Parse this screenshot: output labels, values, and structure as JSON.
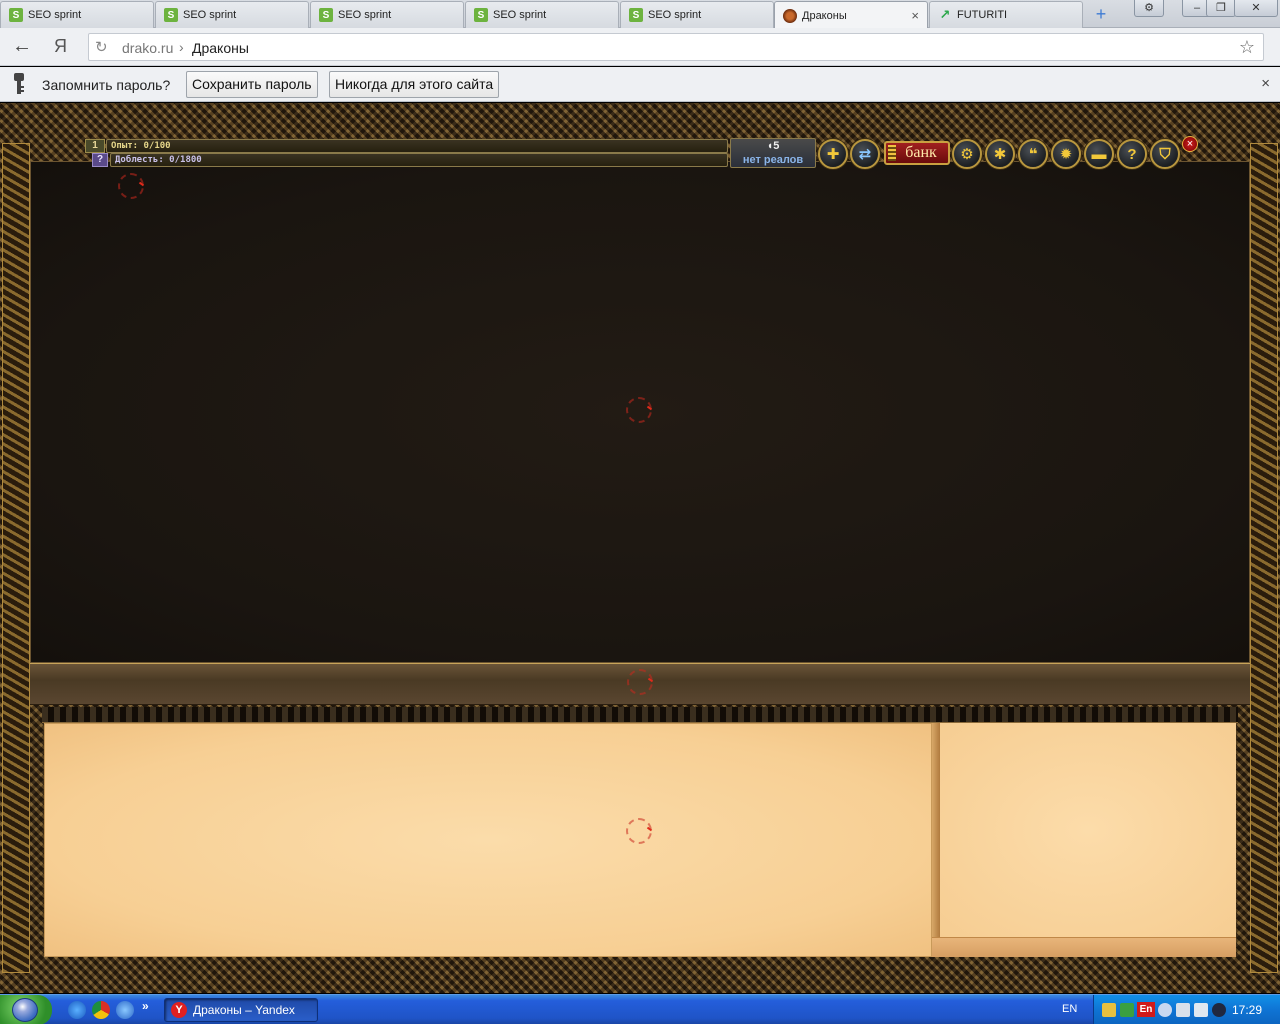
{
  "browser": {
    "tabs": [
      {
        "label": "SEO sprint",
        "favicon": "seosprint-icon"
      },
      {
        "label": "SEO sprint",
        "favicon": "seosprint-icon"
      },
      {
        "label": "SEO sprint",
        "favicon": "seosprint-icon"
      },
      {
        "label": "SEO sprint",
        "favicon": "seosprint-icon"
      },
      {
        "label": "SEO sprint",
        "favicon": "seosprint-icon"
      },
      {
        "label": "Драконы",
        "favicon": "drako-icon",
        "active": true
      },
      {
        "label": "FUTURITI",
        "favicon": "futuriti-icon"
      }
    ],
    "tab_close": "×",
    "new_tab": "+",
    "window_buttons": {
      "settings": "⚙",
      "minimize": "–",
      "maximize": "❐",
      "close": "✕"
    },
    "address": {
      "host": "drako.ru",
      "separator": "›",
      "title": "Драконы"
    },
    "nav": {
      "back": "←",
      "yandex": "Я",
      "reload": "↻",
      "bookmark": "☆"
    }
  },
  "password_bar": {
    "question": "Запомнить пароль?",
    "save_label": "Сохранить пароль",
    "never_label": "Никогда для этого сайта",
    "close": "×"
  },
  "game": {
    "level": "1",
    "experience": {
      "label": "Опыт: 0/100",
      "current": 0,
      "max": 100
    },
    "valor_badge": "?",
    "valor": {
      "label": "Доблесть: 0/1800",
      "current": 0,
      "max": 1800
    },
    "reals_count": "5",
    "reals_text": "нет реалов",
    "bank_label": "банк",
    "close_label": "×",
    "toolbar_icons": [
      "coin-plus-icon",
      "swap-icon",
      "bank-icon",
      "gear-icon",
      "beetle-icon",
      "chat-bubbles-icon",
      "sun-icon",
      "book-icon",
      "help-icon",
      "clan-shield-icon"
    ]
  },
  "taskbar": {
    "quick_launch_more": "»",
    "task_label": "Драконы – Yandex",
    "language": "EN",
    "tray_lang_badge": "En",
    "clock": "17:29"
  },
  "colors": {
    "parchment": "#f7cf94",
    "game_dark": "#1a1510",
    "bank_red": "#8a1414",
    "taskbar_blue": "#245edb",
    "gold_frame": "#b8963e"
  }
}
